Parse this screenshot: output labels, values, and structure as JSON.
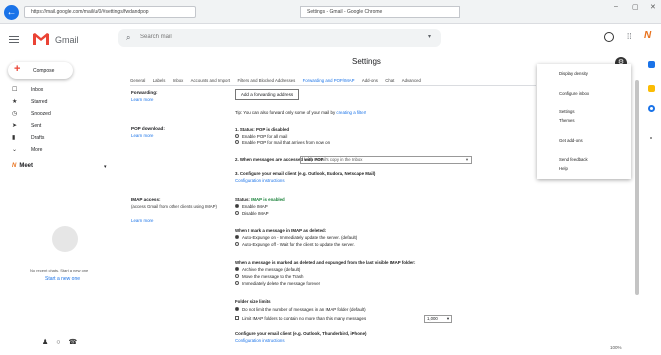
{
  "browser": {
    "url": "https://mail.google.com/mail/u/0/#settings/fwdandpop",
    "tab_title": "Settings - Gmail - Google Chrome",
    "window_controls": [
      "–",
      "▢",
      "✕"
    ]
  },
  "header": {
    "app_name": "Gmail",
    "search_placeholder": "Search mail"
  },
  "sidebar": {
    "compose_label": "Compose",
    "items": [
      {
        "icon": "inbox-icon",
        "glyph": "☐",
        "label": "Inbox"
      },
      {
        "icon": "star-icon",
        "glyph": "★",
        "label": "Starred"
      },
      {
        "icon": "clock-icon",
        "glyph": "◷",
        "label": "Snoozed"
      },
      {
        "icon": "send-icon",
        "glyph": "➤",
        "label": "Sent"
      },
      {
        "icon": "draft-icon",
        "glyph": "▮",
        "label": "Drafts"
      },
      {
        "icon": "chevron-down-icon",
        "glyph": "⌄",
        "label": "More"
      }
    ],
    "meet_title": "Meet",
    "note": "No recent chats. Start a new one",
    "note_link": "Start a new one"
  },
  "settings": {
    "title": "Settings",
    "tabs": [
      "General",
      "Labels",
      "Inbox",
      "Accounts and Import",
      "Filters and Blocked Addresses",
      "Forwarding and POP/IMAP",
      "Add-ons",
      "Chat",
      "Advanced"
    ],
    "active_tab": "Forwarding and POP/IMAP",
    "forwarding": {
      "label": "Forwarding:",
      "learn_more": "Learn more",
      "add_button": "Add a forwarding address",
      "tip": "Tip: You can also forward only some of your mail by",
      "tip_link": "creating a filter!"
    },
    "pop": {
      "label": "POP download:",
      "learn_more": "Learn more",
      "status": "1. Status: POP is disabled",
      "opt1": "Enable POP for all mail",
      "opt2": "Enable POP for mail that arrives from now on",
      "q2": "2. When messages are accessed with POP",
      "q2_select": "keep Gmail's copy in the Inbox",
      "q3": "3. Configure your email client (e.g. Outlook, Eudora, Netscape Mail)",
      "q3_link": "Configuration instructions"
    },
    "imap": {
      "label": "IMAP access:",
      "sub": "(access Gmail from other clients using IMAP)",
      "learn_more": "Learn more",
      "status_prefix": "Status:",
      "status_value": "IMAP is enabled",
      "opt_enable": "Enable IMAP",
      "opt_disable": "Disable IMAP",
      "deleted_q": "When I mark a message in IMAP as deleted:",
      "deleted_opt1": "Auto-Expunge on - Immediately update the server. (default)",
      "deleted_opt2": "Auto-Expunge off - Wait for the client to update the server.",
      "expunged_q": "When a message is marked as deleted and expunged from the last visible IMAP folder:",
      "expunged_opt1": "Archive the message (default)",
      "expunged_opt2": "Move the message to the Trash",
      "expunged_opt3": "Immediately delete the message forever",
      "folder_q": "Folder size limits",
      "folder_opt1": "Do not limit the number of messages in an IMAP folder (default)",
      "folder_opt2": "Limit IMAP folders to contain no more than this many messages",
      "folder_select": "1,000",
      "client_q": "Configure your email client (e.g. Outlook, Thunderbird, iPhone)",
      "client_link": "Configuration instructions"
    }
  },
  "quick_menu": {
    "items": [
      "Display density",
      "Configure inbox",
      "Settings",
      "Themes",
      "Get add-ons",
      "Send feedback",
      "Help"
    ]
  },
  "status": {
    "zoom": "100%"
  },
  "colors": {
    "accent": "#1a73e8",
    "gmail_red": "#ea4335",
    "green": "#188038"
  }
}
